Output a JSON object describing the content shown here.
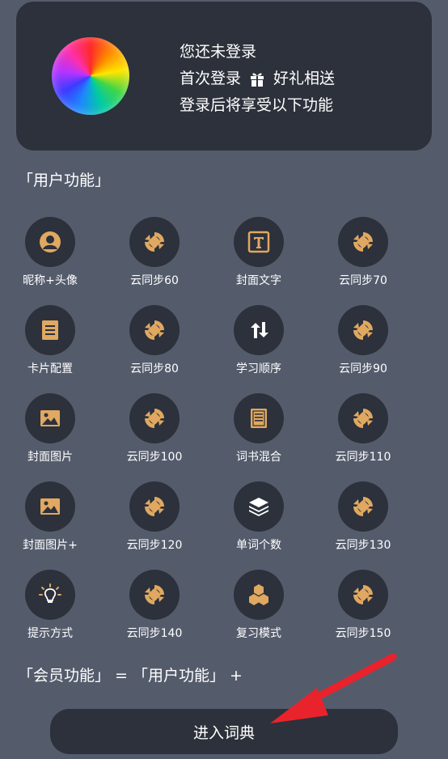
{
  "login": {
    "line1": "您还未登录",
    "line2_prefix": "首次登录",
    "line2_suffix": "好礼相送",
    "line3": "登录后将享受以下功能"
  },
  "section_title": "「用户功能」",
  "features": [
    {
      "label": "昵称+头像",
      "icon": "user-icon"
    },
    {
      "label": "云同步60",
      "icon": "sync-icon"
    },
    {
      "label": "封面文字",
      "icon": "text-icon"
    },
    {
      "label": "云同步70",
      "icon": "sync-icon"
    },
    {
      "label": "卡片配置",
      "icon": "card-icon"
    },
    {
      "label": "云同步80",
      "icon": "sync-icon"
    },
    {
      "label": "学习顺序",
      "icon": "sort-icon"
    },
    {
      "label": "云同步90",
      "icon": "sync-icon"
    },
    {
      "label": "封面图片",
      "icon": "image-icon"
    },
    {
      "label": "云同步100",
      "icon": "sync-icon"
    },
    {
      "label": "词书混合",
      "icon": "book-icon"
    },
    {
      "label": "云同步110",
      "icon": "sync-icon"
    },
    {
      "label": "封面图片+",
      "icon": "image-icon"
    },
    {
      "label": "云同步120",
      "icon": "sync-icon"
    },
    {
      "label": "单词个数",
      "icon": "layers-icon"
    },
    {
      "label": "云同步130",
      "icon": "sync-icon"
    },
    {
      "label": "提示方式",
      "icon": "lightbulb-icon"
    },
    {
      "label": "云同步140",
      "icon": "sync-icon"
    },
    {
      "label": "复习模式",
      "icon": "hexagons-icon"
    },
    {
      "label": "云同步150",
      "icon": "sync-icon"
    }
  ],
  "member_line": "「会员功能」 = 「用户功能」 +",
  "enter_button": "进入词典",
  "colors": {
    "background": "#545c6c",
    "card": "#2c313b",
    "icon_accent": "#e0a860",
    "arrow": "#e8232b"
  }
}
